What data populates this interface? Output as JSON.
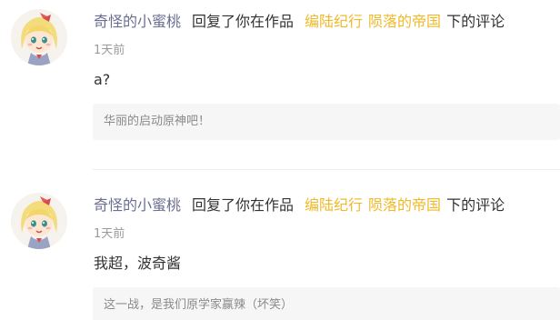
{
  "replies": [
    {
      "username": "奇怪的小蜜桃",
      "action": "回复了你在作品",
      "work_series": "编陆纪行",
      "work_title": "陨落的帝国",
      "tail": "下的评论",
      "time": "1天前",
      "content": "a?",
      "quoted_comment": "华丽的启动原神吧！",
      "avatar_icon": "anime-girl-avatar-icon"
    },
    {
      "username": "奇怪的小蜜桃",
      "action": "回复了你在作品",
      "work_series": "编陆纪行",
      "work_title": "陨落的帝国",
      "tail": "下的评论",
      "time": "1天前",
      "content": "我超，波奇酱",
      "quoted_comment": "这一战，是我们原学家赢辣（坏笑）",
      "avatar_icon": "anime-girl-avatar-icon"
    }
  ],
  "colors": {
    "username": "#6b6e90",
    "work_link": "#efb92a",
    "meta": "#9a9a9a",
    "quote_bg": "#f6f6f6"
  }
}
